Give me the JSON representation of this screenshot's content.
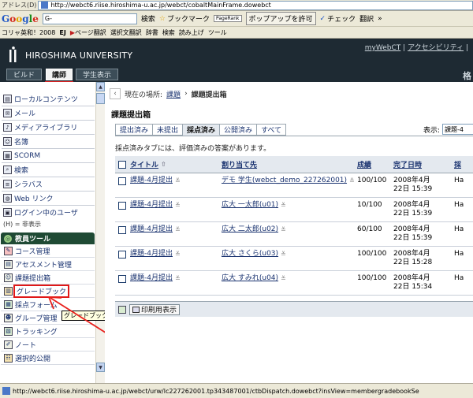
{
  "browser": {
    "address_label": "アドレス(D)",
    "url": "http://webct6.riise.hiroshima-u.ac.jp/webct/cobaltMainFrame.dowebct",
    "google_search_value": "G-",
    "google_toolbar": [
      "検索",
      "ブックマーク",
      "PageRank",
      "ポップアップを許可",
      "チェック",
      "翻訳"
    ],
    "library_toolbar": [
      "コリャ英和！2008",
      "EJ",
      "ページ翻訳",
      "選択文翻訳",
      "辞書",
      "検索",
      "読み上げ",
      "ツール"
    ]
  },
  "header": {
    "university_name": "HIROSHIMA UNIVERSITY",
    "links": [
      "myWebCT",
      "アクセシビリティ"
    ],
    "roles": [
      "ビルド",
      "講師",
      "学生表示"
    ],
    "active_role": "講師",
    "right_glyph": "格"
  },
  "sidebar": {
    "nav_items": [
      {
        "label": "ローカルコンテンツ",
        "icon": "folder-icon"
      },
      {
        "label": "メール",
        "icon": "mail-icon"
      },
      {
        "label": "メディアライブラリ",
        "icon": "media-icon"
      },
      {
        "label": "名簿",
        "icon": "people-icon"
      },
      {
        "label": "SCORM",
        "icon": "scorm-icon"
      },
      {
        "label": "検索",
        "icon": "search-icon"
      },
      {
        "label": "シラバス",
        "icon": "syllabus-icon"
      },
      {
        "label": "Web リンク",
        "icon": "globe-icon"
      },
      {
        "label": "ログイン中のユーザ",
        "icon": "user-icon"
      }
    ],
    "legend": "(H) = 非表示",
    "tools_title": "教員ツール",
    "tools": [
      {
        "label": "コース管理",
        "icon": "course-icon"
      },
      {
        "label": "アセスメント管理",
        "icon": "assessment-icon"
      },
      {
        "label": "課題提出箱",
        "icon": "dropbox-icon"
      },
      {
        "label": "グレードブック",
        "icon": "gradebook-icon"
      },
      {
        "label": "採点フォーム",
        "icon": "form-icon"
      },
      {
        "label": "グループ管理",
        "icon": "group-icon"
      },
      {
        "label": "トラッキング",
        "icon": "tracking-icon"
      },
      {
        "label": "ノート",
        "icon": "note-icon"
      },
      {
        "label": "選択的公開",
        "icon": "release-icon"
      }
    ],
    "highlighted_tool": "グレードブック",
    "tooltip": "グレードブック"
  },
  "main": {
    "breadcrumb_prefix": "現在の場所:",
    "breadcrumb_link": "課題",
    "breadcrumb_current": "課題提出箱",
    "title": "課題提出箱",
    "tabs": [
      "提出済み",
      "未提出",
      "採点済み",
      "公開済み",
      "すべて"
    ],
    "active_tab": "採点済み",
    "display_label": "表示:",
    "display_value": "課題-4",
    "note": "採点済みタブには、評価済みの答案があります。",
    "columns": [
      "タイトル",
      "割り当て先",
      "成績",
      "完了日時",
      "採"
    ],
    "rows": [
      {
        "title": "課題-4月提出",
        "assignee": "デモ 学生(webct_demo_227262001)",
        "grade": "100/100",
        "date": "2008年4月22日 15:39",
        "extra": "Ha"
      },
      {
        "title": "課題-4月提出",
        "assignee": "広大 一太郎(u01)",
        "grade": "10/100",
        "date": "2008年4月22日 15:39",
        "extra": "Ha"
      },
      {
        "title": "課題-4月提出",
        "assignee": "広大 二太郎(u02)",
        "grade": "60/100",
        "date": "2008年4月22日 15:39",
        "extra": "Ha"
      },
      {
        "title": "課題-4月提出",
        "assignee": "広大 さくら(u03)",
        "grade": "100/100",
        "date": "2008年4月22日 15:28",
        "extra": "Ha"
      },
      {
        "title": "課題-4月提出",
        "assignee": "広大 すみれ(u04)",
        "grade": "100/100",
        "date": "2008年4月22日 15:34",
        "extra": "Ha"
      }
    ],
    "print_label": "印刷用表示"
  },
  "status": {
    "url": "http://webct6.riise.hiroshima-u.ac.jp/webct/urw/lc227262001.tp343487001/ctbDispatch.dowebct?insView=membergradebookSe"
  }
}
